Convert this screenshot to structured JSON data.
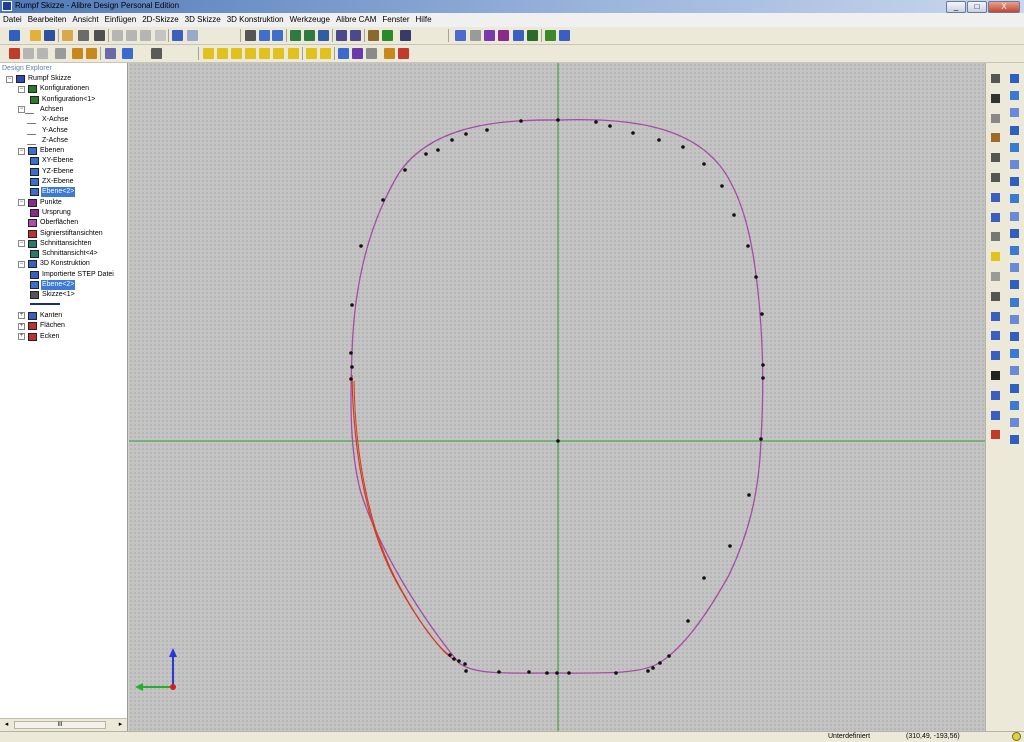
{
  "window": {
    "title": "Rumpf Skizze - Alibre Design Personal Edition",
    "min_glyph": "_",
    "max_glyph": "□",
    "close_glyph": "X"
  },
  "menu": [
    "Datei",
    "Bearbeiten",
    "Ansicht",
    "Einfügen",
    "2D-Skizze",
    "3D Skizze",
    "3D Konstruktion",
    "Werkzeuge",
    "Alibre CAM",
    "Fenster",
    "Hilfe"
  ],
  "explorer": {
    "header": "Design Explorer",
    "tree": [
      {
        "label": "Rumpf Skizze",
        "level": 0,
        "expander": "−",
        "icon": "part-icon",
        "color": "#2b4bb3"
      },
      {
        "label": "Konfigurationen",
        "level": 1,
        "expander": "−",
        "icon": "config-icon",
        "color": "#2a7a2a"
      },
      {
        "label": "Konfiguration<1>",
        "level": 2,
        "expander": "",
        "icon": "config-table-icon",
        "color": "#2a7a2a"
      },
      {
        "label": "Achsen",
        "level": 1,
        "expander": "−",
        "icon": "axis-icon",
        "color": "#777777"
      },
      {
        "label": "X-Achse",
        "level": 2,
        "expander": "",
        "icon": "axis-line-icon",
        "color": "#777777"
      },
      {
        "label": "Y-Achse",
        "level": 2,
        "expander": "",
        "icon": "axis-line-icon",
        "color": "#777777"
      },
      {
        "label": "Z-Achse",
        "level": 2,
        "expander": "",
        "icon": "axis-line-icon",
        "color": "#777777"
      },
      {
        "label": "Ebenen",
        "level": 1,
        "expander": "−",
        "icon": "planes-icon",
        "color": "#3a6fd0"
      },
      {
        "label": "XY-Ebene",
        "level": 2,
        "expander": "",
        "icon": "plane-icon",
        "color": "#3a6fd0"
      },
      {
        "label": "YZ-Ebene",
        "level": 2,
        "expander": "",
        "icon": "plane-icon",
        "color": "#3a6fd0"
      },
      {
        "label": "ZX-Ebene",
        "level": 2,
        "expander": "",
        "icon": "plane-icon",
        "color": "#3a6fd0"
      },
      {
        "label": "Ebene<2>",
        "level": 2,
        "expander": "",
        "icon": "plane-icon",
        "color": "#3a6fd0",
        "selected": true
      },
      {
        "label": "Punkte",
        "level": 1,
        "expander": "−",
        "icon": "points-icon",
        "color": "#8a2a8a"
      },
      {
        "label": "Ursprung",
        "level": 2,
        "expander": "",
        "icon": "origin-icon",
        "color": "#8a2a8a"
      },
      {
        "label": "Oberflächen",
        "level": 1,
        "expander": "",
        "icon": "surfaces-icon",
        "color": "#b04ab0"
      },
      {
        "label": "Signierstiftansichten",
        "level": 1,
        "expander": "",
        "icon": "pen-views-icon",
        "color": "#c03030"
      },
      {
        "label": "Schnittansichten",
        "level": 1,
        "expander": "−",
        "icon": "section-views-icon",
        "color": "#2a7a6a"
      },
      {
        "label": "Schnittansicht<4>",
        "level": 2,
        "expander": "",
        "icon": "section-view-icon",
        "color": "#2a7a6a"
      },
      {
        "label": "3D Konstruktion",
        "level": 1,
        "expander": "−",
        "icon": "construction-3d-icon",
        "color": "#3a5fc0"
      },
      {
        "label": "Importierte STEP Datei",
        "level": 2,
        "expander": "",
        "icon": "step-import-icon",
        "color": "#3a5fc0"
      },
      {
        "label": "Ebene<2>",
        "level": 2,
        "expander": "",
        "icon": "plane-icon",
        "color": "#3a6fd0",
        "selected": true
      },
      {
        "label": "Skizze<1>",
        "level": 2,
        "expander": "",
        "icon": "sketch-icon",
        "color": "#555555"
      },
      {
        "label": "",
        "level": 2,
        "expander": "",
        "icon": "axis-triad-icon",
        "color": "#1a2a8a"
      },
      {
        "label": "Kanten",
        "level": 1,
        "expander": "+",
        "icon": "edges-icon",
        "color": "#3a5fc0"
      },
      {
        "label": "Flächen",
        "level": 1,
        "expander": "+",
        "icon": "faces-icon",
        "color": "#c03030"
      },
      {
        "label": "Ecken",
        "level": 1,
        "expander": "+",
        "icon": "corners-icon",
        "color": "#c03030"
      }
    ],
    "scroll_glyph": "III"
  },
  "status": {
    "state": "Unterdefiniert",
    "coords": "(310,49, -193,56)"
  },
  "colors": {
    "grid_axis": "#2f9a2f",
    "curve": "#a84aa8",
    "curve_alt": "#d23a1e",
    "point": "#111111",
    "triad_y": "#2a36d8",
    "triad_x": "#22b22a"
  }
}
